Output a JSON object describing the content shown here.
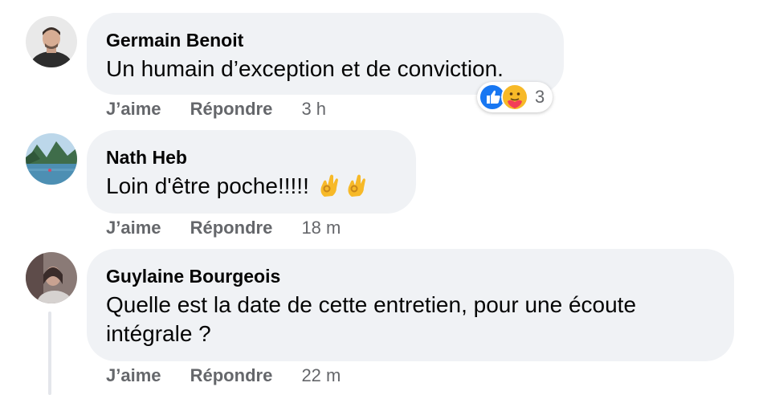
{
  "colors": {
    "bubble_bg": "#f0f2f5",
    "meta_text": "#65676b",
    "like_blue": "#1877f2",
    "emoji_yellow": "#f7b928"
  },
  "comments": [
    {
      "author": "Germain Benoit",
      "text": "Un humain d’exception et de conviction.",
      "like_label": "J’aime",
      "reply_label": "Répondre",
      "time": "3 h",
      "reactions": {
        "icons": [
          "like-icon",
          "care-icon"
        ],
        "count": "3"
      },
      "avatar": "avatar-man-in-jacket"
    },
    {
      "author": "Nath Heb",
      "text": "Loin d'être poche!!!!!",
      "emojis": [
        "ok-hand-icon",
        "ok-hand-icon"
      ],
      "like_label": "J’aime",
      "reply_label": "Répondre",
      "time": "18 m",
      "avatar": "avatar-lake-landscape"
    },
    {
      "author": "Guylaine Bourgeois",
      "text_line1": "Quelle est la date de cette entretien, pour une écoute",
      "text_line2": "intégrale ?",
      "like_label": "J’aime",
      "reply_label": "Répondre",
      "time": "22 m",
      "avatar": "avatar-person-portrait"
    }
  ]
}
